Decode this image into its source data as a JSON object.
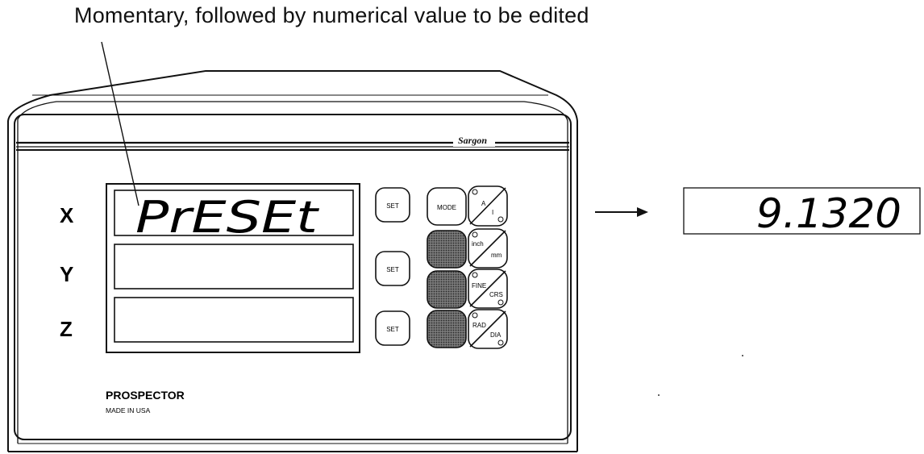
{
  "caption": "Momentary, followed by numerical value to be edited",
  "unit": {
    "brand": "Sargon",
    "model": "PROSPECTOR",
    "made_in": "MADE IN USA",
    "axes": [
      {
        "label": "X",
        "display": "PrESEt",
        "set_label": "SET"
      },
      {
        "label": "Y",
        "display": "",
        "set_label": "SET"
      },
      {
        "label": "Z",
        "display": "",
        "set_label": "SET"
      }
    ],
    "keys": {
      "mode": "MODE",
      "abs_inc": {
        "top": "A",
        "bottom": "I"
      },
      "inch_mm": {
        "top": "inch",
        "bottom": "mm"
      },
      "fine_crs": {
        "top": "FINE",
        "bottom": "CRS"
      },
      "rad_dia": {
        "top": "RAD",
        "bottom": "DIA"
      }
    }
  },
  "result_display": "9.1320"
}
